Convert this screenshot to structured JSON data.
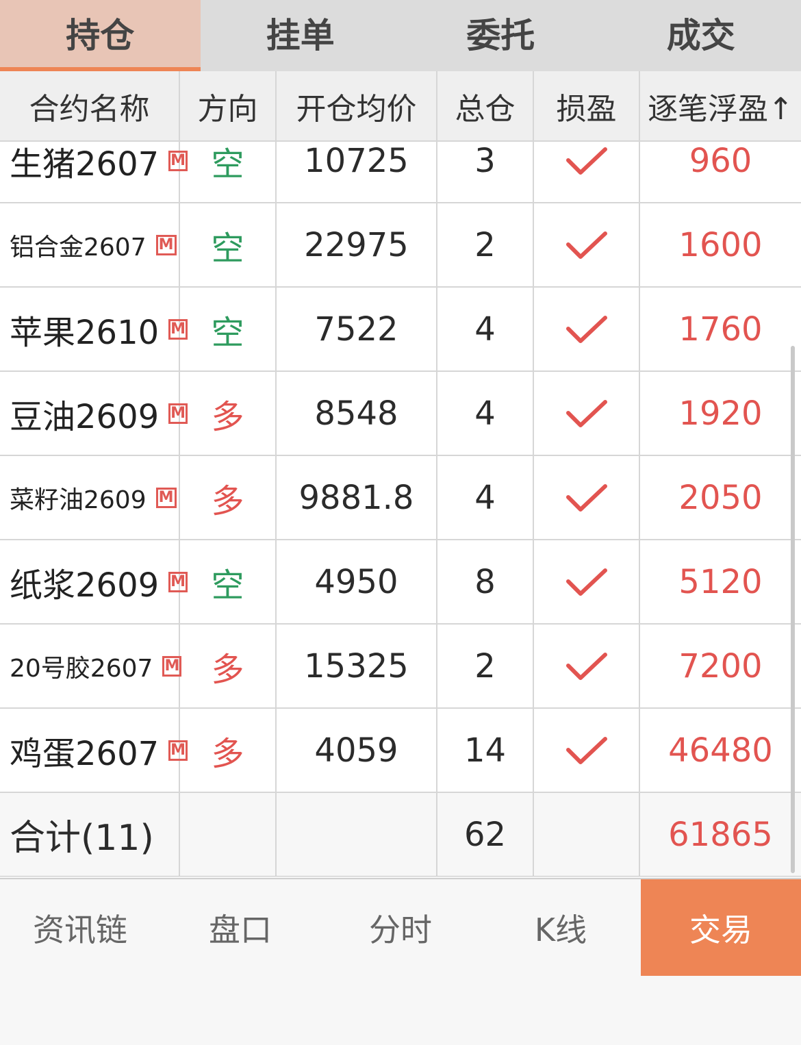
{
  "tabs": [
    "持仓",
    "挂单",
    "委托",
    "成交"
  ],
  "header": {
    "name": "合约名称",
    "direction": "方向",
    "avg_price": "开仓均价",
    "total_pos": "总仓",
    "stop": "损盈",
    "float_pnl": "逐笔浮盈↑"
  },
  "badge": "M",
  "rows": [
    {
      "name": "生猪2607",
      "direction": "空",
      "avg_price": "10725",
      "total_pos": "3",
      "pnl": "960"
    },
    {
      "name": "铝合金2607",
      "direction": "空",
      "avg_price": "22975",
      "total_pos": "2",
      "pnl": "1600"
    },
    {
      "name": "苹果2610",
      "direction": "空",
      "avg_price": "7522",
      "total_pos": "4",
      "pnl": "1760"
    },
    {
      "name": "豆油2609",
      "direction": "多",
      "avg_price": "8548",
      "total_pos": "4",
      "pnl": "1920"
    },
    {
      "name": "菜籽油2609",
      "direction": "多",
      "avg_price": "9881.8",
      "total_pos": "4",
      "pnl": "2050"
    },
    {
      "name": "纸浆2609",
      "direction": "空",
      "avg_price": "4950",
      "total_pos": "8",
      "pnl": "5120"
    },
    {
      "name": "20号胶2607",
      "direction": "多",
      "avg_price": "15325",
      "total_pos": "2",
      "pnl": "7200"
    },
    {
      "name": "鸡蛋2607",
      "direction": "多",
      "avg_price": "4059",
      "total_pos": "14",
      "pnl": "46480"
    }
  ],
  "total": {
    "label": "合计(11)",
    "total_pos": "62",
    "pnl": "61865"
  },
  "bottom_nav": [
    "资讯链",
    "盘口",
    "分时",
    "K线",
    "交易"
  ],
  "colors": {
    "accent": "#ee8555",
    "short": "#2e9b5e",
    "long": "#e25450",
    "pnl": "#e25450"
  }
}
